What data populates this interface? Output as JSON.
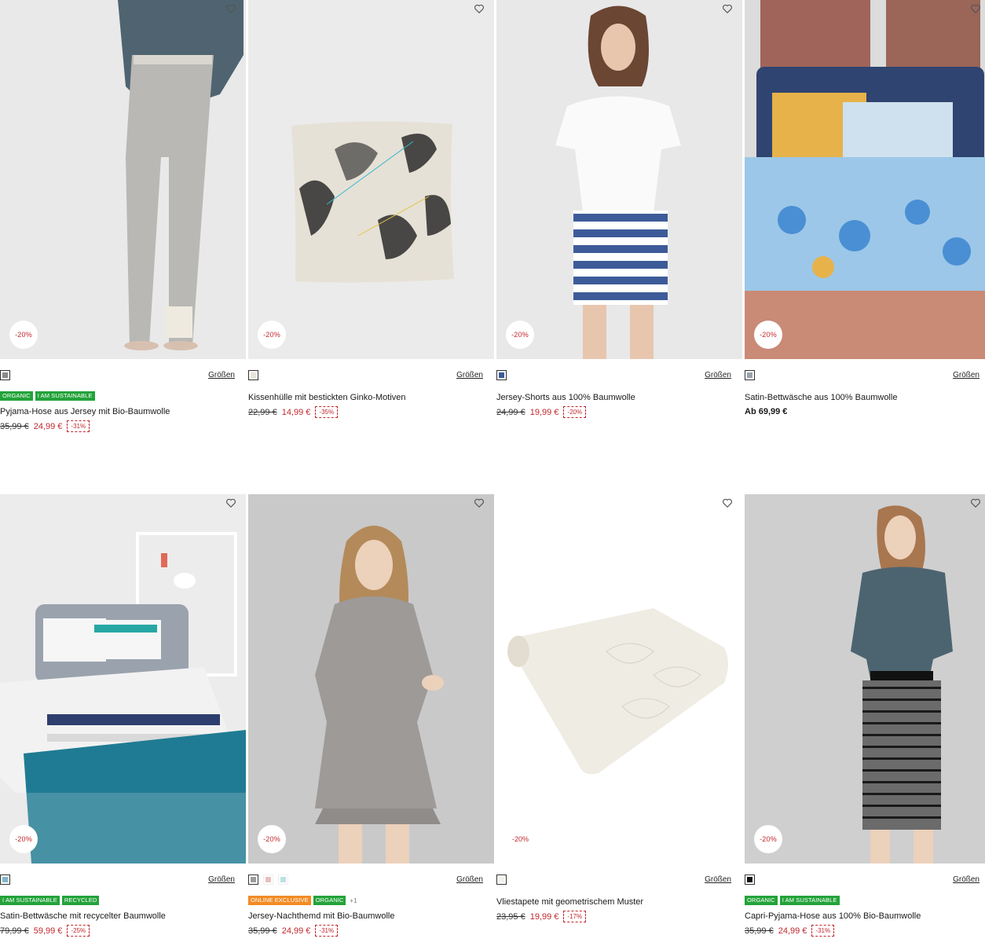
{
  "colors": {
    "sale_red": "#c1272d",
    "badge_green": "#23a33a",
    "badge_orange": "#f28b24"
  },
  "icons": {
    "wishlist": "heart-outline-icon"
  },
  "products": [
    {
      "title": "Pyjama-Hose aus Jersey mit Bio-Baumwolle",
      "discount_label": "-20%",
      "sizes_label": "Größen",
      "swatches": [
        "#8a8a8a"
      ],
      "badges": [
        {
          "label": "ORGANIC",
          "color": "green"
        },
        {
          "label": "I AM SUSTAINABLE",
          "color": "green"
        }
      ],
      "old_price": "35,99 €",
      "new_price": "24,99 €",
      "percent": "-31%",
      "from_price": ""
    },
    {
      "title": "Kissenhülle mit bestickten Ginko-Motiven",
      "discount_label": "-20%",
      "sizes_label": "Größen",
      "swatches": [
        "#e8e4da"
      ],
      "badges": [],
      "old_price": "22,99 €",
      "new_price": "14,99 €",
      "percent": "-35%",
      "from_price": ""
    },
    {
      "title": "Jersey-Shorts aus 100% Baumwolle",
      "discount_label": "-20%",
      "sizes_label": "Größen",
      "swatches": [
        "#3d5b99"
      ],
      "badges": [],
      "old_price": "24,99 €",
      "new_price": "19,99 €",
      "percent": "-20%",
      "from_price": ""
    },
    {
      "title": "Satin-Bettwäsche aus 100% Baumwolle",
      "discount_label": "-20%",
      "sizes_label": "Größen",
      "swatches": [
        "#9aa3ab"
      ],
      "badges": [],
      "old_price": "",
      "new_price": "",
      "percent": "",
      "from_price": "Ab 69,99 €"
    },
    {
      "title": "Satin-Bettwäsche mit recycelter Baumwolle",
      "discount_label": "-20%",
      "sizes_label": "Größen",
      "swatches": [
        "#7fb8c9"
      ],
      "badges": [
        {
          "label": "I AM SUSTAINABLE",
          "color": "green"
        },
        {
          "label": "RECYCLED",
          "color": "green"
        }
      ],
      "old_price": "79,99 €",
      "new_price": "59,99 €",
      "percent": "-25%",
      "from_price": ""
    },
    {
      "title": "Jersey-Nachthemd mit Bio-Baumwolle",
      "discount_label": "-20%",
      "sizes_label": "Größen",
      "swatches": [
        "#9c9c9c",
        "#e8bfc4",
        "#bfe0e3"
      ],
      "badges": [
        {
          "label": "ONLINE EXCLUSIVE",
          "color": "orange"
        },
        {
          "label": "ORGANIC",
          "color": "green"
        }
      ],
      "more_badges": "+1",
      "old_price": "35,99 €",
      "new_price": "24,99 €",
      "percent": "-31%",
      "from_price": ""
    },
    {
      "title": "Vliestapete mit geometrischem Muster",
      "discount_label": "-20%",
      "sizes_label": "Größen",
      "swatches": [
        "#f4f1e8"
      ],
      "badges": [],
      "old_price": "23,95 €",
      "new_price": "19,99 €",
      "percent": "-17%",
      "from_price": ""
    },
    {
      "title": "Capri-Pyjama-Hose aus 100% Bio-Baumwolle",
      "discount_label": "-20%",
      "sizes_label": "Größen",
      "swatches": [
        "#111111"
      ],
      "badges": [
        {
          "label": "ORGANIC",
          "color": "green"
        },
        {
          "label": "I AM SUSTAINABLE",
          "color": "green"
        }
      ],
      "old_price": "35,99 €",
      "new_price": "24,99 €",
      "percent": "-31%",
      "from_price": ""
    }
  ]
}
